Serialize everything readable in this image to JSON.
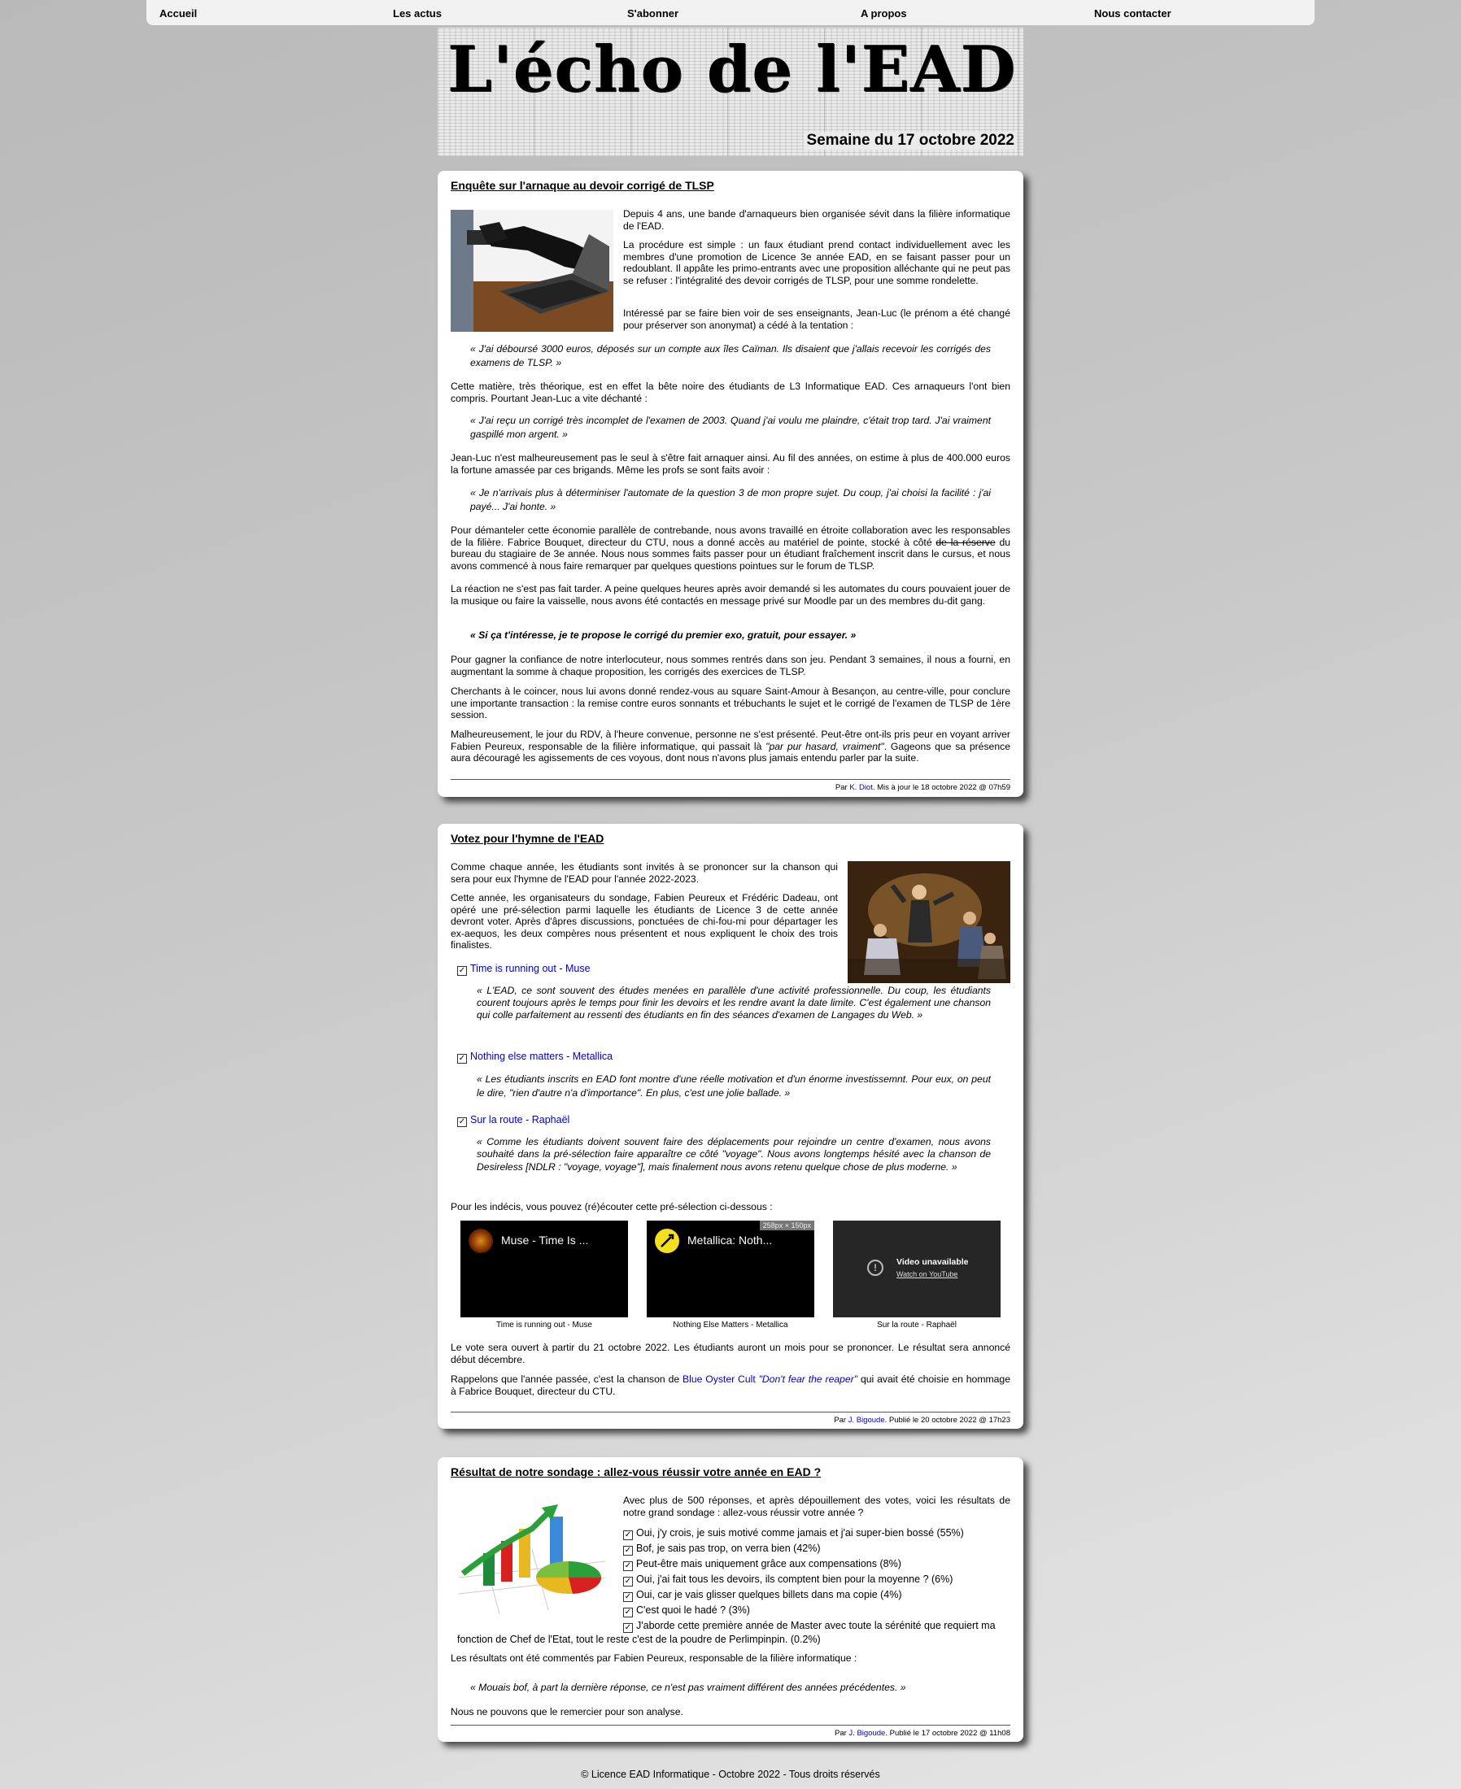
{
  "nav": [
    {
      "label": "Accueil"
    },
    {
      "label": "Les actus"
    },
    {
      "label": "S'abonner"
    },
    {
      "label": "A propos"
    },
    {
      "label": "Nous contacter"
    }
  ],
  "masthead": {
    "title": "L'écho de l'EAD",
    "date": "Semaine du 17 octobre 2022"
  },
  "article1": {
    "title": "Enquête sur l'arnaque au devoir corrigé de TLSP",
    "p1": "Depuis 4 ans, une bande d'arnaqueurs bien organisée sévit dans la filière informatique de l'EAD.",
    "p2": "La procédure est simple : un faux étudiant prend contact individuellement avec les membres d'une promotion de Licence 3e année EAD, en se faisant passer pour un redoublant. Il appâte les primo-entrants avec une proposition alléchante qui ne peut pas se refuser : l'intégralité des devoir corrigés de TLSP, pour une somme rondelette.",
    "p3": "Intéressé par se faire bien voir de ses enseignants, Jean-Luc (le prénom a été changé pour préserver son anonymat) a cédé à la tentation :",
    "q1": "«  J'ai déboursé 3000 euros, déposés sur un compte aux îles Caïman. Ils disaient que j'allais recevoir les corrigés des examens de TLSP.  »",
    "p4": "Cette matière, très théorique, est en effet la bête noire des étudiants de L3 Informatique EAD. Ces arnaqueurs l'ont bien compris. Pourtant Jean-Luc a vite déchanté :",
    "q2": "«  J'ai reçu un corrigé très incomplet de l'examen de 2003. Quand j'ai voulu me plaindre, c'était trop tard. J'ai vraiment gaspillé mon argent.  »",
    "p5": "Jean-Luc n'est malheureusement pas le seul à s'être fait arnaquer ainsi. Au fil des années, on estime à plus de 400.000 euros la fortune amassée par ces brigands. Même les profs se sont faits avoir :",
    "q3": "«  Je n'arrivais plus à déterminiser l'automate de la question 3 de mon propre sujet. Du coup, j'ai choisi la facilité : j'ai payé... J'ai honte.  »",
    "p6a": "Pour démanteler cette économie parallèle de contrebande, nous avons travaillé en étroite collaboration avec les responsables de la filière. Fabrice Bouquet, directeur du CTU, nous a donné accès au matériel de pointe, stocké à côté ",
    "p6strike": "de la réserve",
    "p6b": " du bureau du stagiaire de 3e année. Nous nous sommes faits passer pour un étudiant fraîchement inscrit dans le cursus, et nous avons commencé à nous faire remarquer par quelques questions pointues sur le forum de TLSP.",
    "p7": "La réaction ne s'est pas fait tarder. A peine quelques heures après avoir demandé si les automates du cours pouvaient jouer de la musique ou faire la vaisselle, nous avons été contactés en message privé sur Moodle par un des membres du-dit gang.",
    "q4": "« Si ça t'intéresse, je te propose le corrigé du premier exo, gratuit, pour essayer.  »",
    "p8": "Pour gagner la confiance de notre interlocuteur, nous sommes rentrés dans son jeu. Pendant 3 semaines, il nous a fourni, en augmentant la somme à chaque proposition, les corrigés des exercices de TLSP.",
    "p9": "Cherchants à le coincer, nous lui avons donné rendez-vous au square Saint-Amour à Besançon, au centre-ville, pour conclure une importante transaction : la remise contre euros sonnants et trébuchants le sujet et le corrigé de l'examen de TLSP de 1ère session.",
    "p10a": "Malheureusement, le jour du RDV, à l'heure convenue, personne ne s'est présenté. Peut-être ont-ils pris peur en voyant arriver Fabien Peureux, responsable de la filière informatique, qui passait là ",
    "p10em": "\"par pur hasard, vraiment\"",
    "p10b": ". Gageons que sa présence aura découragé les agissements de ces voyous, dont nous n'avons plus jamais entendu parler par la suite.",
    "footer_pre": "Par ",
    "author": "K. Diot",
    "footer_post": ". Mis à jour le 18 octobre 2022 @ 07h59"
  },
  "article2": {
    "title": "Votez pour l'hymne de l'EAD",
    "p1": "Comme chaque année, les étudiants sont invités à se prononcer sur la chanson qui sera pour eux l'hymne de l'EAD pour l'année 2022-2023.",
    "p2": "Cette année, les organisateurs du sondage, Fabien Peureux et Frédéric Dadeau, ont opéré une pré-sélection parmi laquelle les étudiants de Licence 3 de cette année devront voter. Après d'âpres discussions, ponctuées de chi-fou-mi pour départager les ex-aequos, les deux compères nous présentent et nous expliquent le choix des trois finalistes.",
    "songs": [
      {
        "title": "Time is running out",
        "sep": " - ",
        "artist": "Muse",
        "quote": "«  L'EAD, ce sont souvent des études menées en parallèle d'une activité professionnelle. Du coup, les étudiants courent toujours après le temps pour finir les devoirs et les rendre avant la date limite. C'est également une chanson qui colle parfaitement au ressenti des étudiants en fin des séances d'examen de Langages du Web.  »"
      },
      {
        "title": "Nothing else matters",
        "sep": " - ",
        "artist": "Metallica",
        "quote": "« Les étudiants inscrits en EAD font montre d'une réelle motivation et d'un énorme investissemnt. Pour eux, on peut le dire, \"rien d'autre n'a d'importance\". En plus, c'est une jolie ballade.  »"
      },
      {
        "title": "Sur la route",
        "sep": " - ",
        "artist": "Raphaël",
        "quote": "« Comme les étudiants doivent souvent faire des déplacements pour rejoindre un centre d'examen, nous avons souhaité dans la pré-sélection faire apparaître ce côté \"voyage\". Nous avons longtemps hésité avec la chanson de Desireless [NDLR : \"voyage, voyage\"], mais finalement nous avons retenu quelque chose de plus moderne. »"
      }
    ],
    "p3": "Pour les indécis, vous pouvez (ré)écouter cette pré-sélection ci-dessous :",
    "videos": [
      {
        "title": "Muse - Time Is ...",
        "caption": "Time is running out - Muse"
      },
      {
        "title": "Metallica: Noth...",
        "caption": "Nothing Else Matters - Metallica",
        "badge": "258px × 150px"
      },
      {
        "unavailable": "Video unavailable",
        "watch": "Watch on YouTube",
        "caption": "Sur la route - Raphaël"
      }
    ],
    "p4": "Le vote sera ouvert à partir du 21 octobre 2022. Les étudiants auront un mois pour se prononcer. Le résultat sera annoncé début décembre.",
    "p5a": "Rappelons que l'année passée, c'est la chanson de ",
    "p5link1": "Blue Oyster Cult",
    "p5link2": "\"Don't fear the reaper\"",
    "p5b": " qui avait été choisie en hommage à Fabrice Bouquet, directeur du CTU.",
    "footer_pre": "Par ",
    "author": "J. Bigoude",
    "footer_post": ". Publié le 20 octobre 2022 @ 17h23"
  },
  "article3": {
    "title": "Résultat de notre sondage : allez-vous réussir votre année en EAD ?",
    "p1": "Avec plus de 500 réponses, et après dépouillement des votes, voici les résultats de notre grand sondage : allez-vous réussir votre année ?",
    "results": [
      "Oui, j'y crois, je suis motivé comme jamais et j'ai super-bien bossé (55%)",
      "Bof, je sais pas trop, on verra bien (42%)",
      "Peut-être mais uniquement grâce aux compensations (8%)",
      "Oui, j'ai fait tous les devoirs, ils comptent bien pour la moyenne ? (6%)",
      "Oui, car je vais glisser quelques billets dans ma copie (4%)",
      "C'est quoi le hadé ? (3%)",
      "J'aborde cette première année de Master avec toute la sérénité que requiert ma",
      "fonction de Chef de l'Etat, tout le reste c'est de la poudre de Perlimpinpin. (0.2%)"
    ],
    "p2": "Les résultats ont été commentés par Fabien Peureux, responsable de la filière informatique :",
    "q1": "«  Mouais bof, à part la dernière réponse, ce n'est pas vraiment différent des années précédentes.  »",
    "p3": "Nous ne pouvons que le remercier pour son analyse.",
    "footer_pre": "Par ",
    "author": "J. Bigoude",
    "footer_post": ". Publié le 17 octobre 2022 @ 11h08"
  },
  "copyright": "© Licence EAD Informatique - Octobre 2022 - Tous droits réservés",
  "colors": {
    "link": "#0000cc",
    "nav_bg": "#f2f2f2"
  }
}
